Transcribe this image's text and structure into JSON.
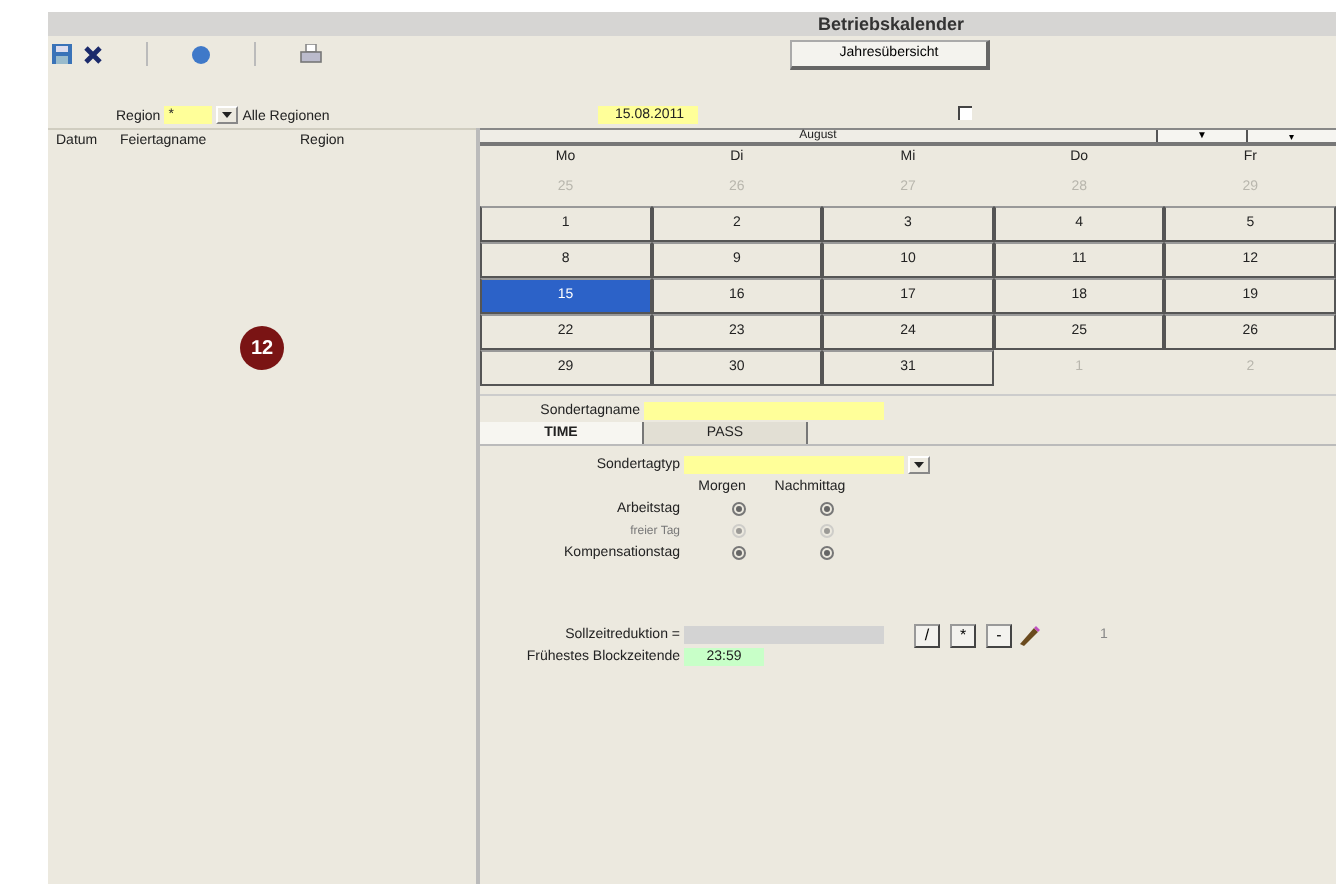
{
  "window": {
    "title": "Betriebskalender"
  },
  "toolbar": {
    "overview_button": "Jahresübersicht"
  },
  "filter": {
    "region_label": "Region",
    "region_value": "*",
    "region_text": "Alle Regionen",
    "date": "15.08.2011",
    "checked": false
  },
  "list": {
    "columns": [
      "Datum",
      "Feiertagname",
      "Region"
    ],
    "badge": "12"
  },
  "calendar": {
    "month": "August",
    "nav": [
      "▼",
      "▾"
    ],
    "weekdays": [
      "Mo",
      "Di",
      "Mi",
      "Do",
      "Fr"
    ],
    "weeks": [
      [
        {
          "day": "25",
          "outside": true,
          "selected": false
        },
        {
          "day": "26",
          "outside": true,
          "selected": false
        },
        {
          "day": "27",
          "outside": true,
          "selected": false
        },
        {
          "day": "28",
          "outside": true,
          "selected": false
        },
        {
          "day": "29",
          "outside": true,
          "selected": false
        }
      ],
      [
        {
          "day": "1",
          "outside": false,
          "selected": false
        },
        {
          "day": "2",
          "outside": false,
          "selected": false
        },
        {
          "day": "3",
          "outside": false,
          "selected": false
        },
        {
          "day": "4",
          "outside": false,
          "selected": false
        },
        {
          "day": "5",
          "outside": false,
          "selected": false
        }
      ],
      [
        {
          "day": "8",
          "outside": false,
          "selected": false
        },
        {
          "day": "9",
          "outside": false,
          "selected": false
        },
        {
          "day": "10",
          "outside": false,
          "selected": false
        },
        {
          "day": "11",
          "outside": false,
          "selected": false
        },
        {
          "day": "12",
          "outside": false,
          "selected": false
        }
      ],
      [
        {
          "day": "15",
          "outside": false,
          "selected": true
        },
        {
          "day": "16",
          "outside": false,
          "selected": false
        },
        {
          "day": "17",
          "outside": false,
          "selected": false
        },
        {
          "day": "18",
          "outside": false,
          "selected": false
        },
        {
          "day": "19",
          "outside": false,
          "selected": false
        }
      ],
      [
        {
          "day": "22",
          "outside": false,
          "selected": false
        },
        {
          "day": "23",
          "outside": false,
          "selected": false
        },
        {
          "day": "24",
          "outside": false,
          "selected": false
        },
        {
          "day": "25",
          "outside": false,
          "selected": false
        },
        {
          "day": "26",
          "outside": false,
          "selected": false
        }
      ],
      [
        {
          "day": "29",
          "outside": false,
          "selected": false
        },
        {
          "day": "30",
          "outside": false,
          "selected": false
        },
        {
          "day": "31",
          "outside": false,
          "selected": false
        },
        {
          "day": "1",
          "outside": true,
          "selected": false
        },
        {
          "day": "2",
          "outside": true,
          "selected": false
        }
      ]
    ]
  },
  "details": {
    "name_label": "Sondertagname",
    "tabs": [
      {
        "label": "TIME",
        "selected": true
      },
      {
        "label": "PASS",
        "selected": false
      }
    ],
    "type_label": "Sondertagtyp",
    "radio_columns": [
      "Morgen",
      "Nachmittag"
    ],
    "radio_rows": [
      {
        "label": "Arbeitstag",
        "disabled": false,
        "selected": [
          true,
          true
        ]
      },
      {
        "label": "freier Tag",
        "disabled": true,
        "selected": [
          true,
          true
        ]
      },
      {
        "label": "Kompensationstag",
        "disabled": false,
        "selected": [
          true,
          true
        ]
      }
    ],
    "reduction_label": "Sollzeitreduktion =",
    "buttons": [
      "/",
      "*",
      "-"
    ],
    "counter": "1",
    "block_label": "Frühestes Blockzeitende",
    "block_value": "23:59"
  }
}
